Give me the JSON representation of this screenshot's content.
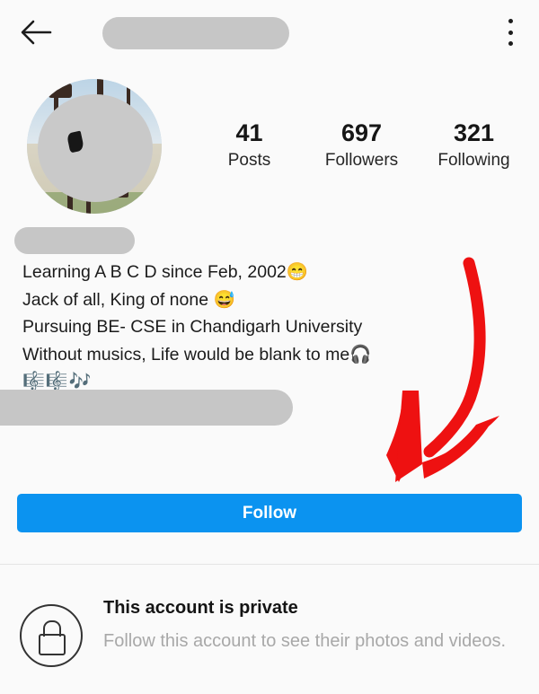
{
  "app": {
    "background_color": "#fafafa",
    "accent_color": "#0b93f0",
    "annotation_color": "#ee1111",
    "redaction_color": "#c6c6c6"
  },
  "topbar": {
    "back_icon": "arrow-left-icon",
    "username_redacted": "",
    "menu_icon": "kebab-menu-icon"
  },
  "profile": {
    "avatar_redacted": "",
    "full_name_redacted": "",
    "stats": [
      {
        "value": "41",
        "label": "Posts"
      },
      {
        "value": "697",
        "label": "Followers"
      },
      {
        "value": "321",
        "label": "Following"
      }
    ],
    "bio": [
      "Learning A B C D since Feb, 2002😁",
      "Jack of all, King of none 😅",
      "Pursuing BE- CSE in Chandigarh University",
      "Without musics, Life would be blank to me🎧",
      "🎼🎼🎶"
    ],
    "bio_link_redacted": ""
  },
  "actions": {
    "follow_label": "Follow"
  },
  "private_notice": {
    "icon": "lock-icon",
    "title": "This account is private",
    "subtitle": "Follow this account to see their photos and videos."
  },
  "annotation": {
    "arrow": "red-arrow-pointing-to-follow-button"
  }
}
